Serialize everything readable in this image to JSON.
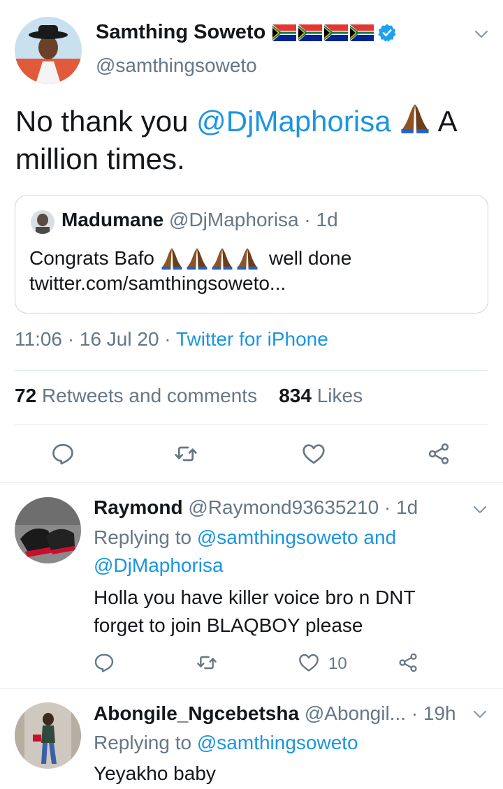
{
  "main_tweet": {
    "author_name": "Samthing Soweto",
    "author_handle": "@samthingsoweto",
    "text_before": "No thank you ",
    "text_mention": "@DjMaphorisa",
    "text_after": " A million times.",
    "quoted": {
      "name": "Madumane",
      "handle": "@DjMaphorisa",
      "time": "· 1d",
      "text_start": "Congrats Bafo",
      "text_end": "well done",
      "link": "twitter.com/samthingsoweto..."
    },
    "time": "11:06",
    "date": "· 16 Jul 20 ·",
    "source": "Twitter for iPhone",
    "retweets_count": "72",
    "retweets_label": "Retweets and comments",
    "likes_count": "834",
    "likes_label": "Likes"
  },
  "replies": [
    {
      "name": "Raymond",
      "handle": "@Raymond93635210",
      "time": "· 1d",
      "replying_prefix": "Replying to ",
      "replying_to_1": "@samthingsoweto",
      "replying_and": " and",
      "replying_to_2": "@DjMaphorisa",
      "text_line1": "Holla you have killer voice bro n DNT",
      "text_line2": "forget to join BLAQBOY please",
      "like_count": "10"
    },
    {
      "name": "Abongile_Ngcebetsha",
      "handle": "@Abongil...",
      "time": "· 19h",
      "replying_prefix": "Replying to ",
      "replying_to_1": "@samthingsoweto",
      "text_line1": "Yeyakho baby"
    }
  ],
  "colors": {
    "link": "#1b95e0",
    "muted": "#657786",
    "text": "#14171a",
    "border": "#e1e8ed"
  },
  "icons": [
    "verified-badge-icon",
    "south-africa-flag-icon",
    "praying-hands-icon",
    "reply-icon",
    "retweet-icon",
    "like-icon",
    "share-icon",
    "chevron-down-icon"
  ]
}
